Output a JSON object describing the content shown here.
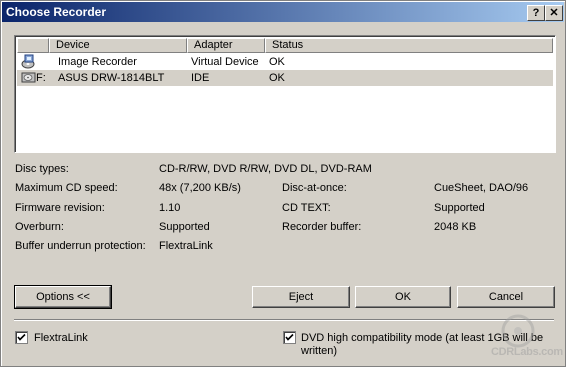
{
  "window": {
    "title": "Choose Recorder",
    "help_button": "?",
    "close_button": "✕"
  },
  "list": {
    "columns": [
      "Device",
      "Adapter",
      "Status"
    ],
    "rows": [
      {
        "prefix": "",
        "device": "Image Recorder",
        "adapter": "Virtual Device",
        "status": "OK",
        "icon": "image-recorder-icon"
      },
      {
        "prefix": "F:",
        "device": "ASUS DRW-1814BLT",
        "adapter": "IDE",
        "status": "OK",
        "icon": "optical-drive-icon"
      }
    ]
  },
  "info": {
    "disc_types_label": "Disc types:",
    "disc_types_value": "CD-R/RW, DVD R/RW, DVD DL, DVD-RAM",
    "max_speed_label": "Maximum CD speed:",
    "max_speed_value": "48x (7,200 KB/s)",
    "firmware_label": "Firmware revision:",
    "firmware_value": "1.10",
    "overburn_label": "Overburn:",
    "overburn_value": "Supported",
    "buffer_protect_label": "Buffer underrun protection:",
    "buffer_protect_value": "FlextraLink",
    "dao_label": "Disc-at-once:",
    "dao_value": "CueSheet, DAO/96",
    "cdtext_label": "CD TEXT:",
    "cdtext_value": "Supported",
    "rec_buffer_label": "Recorder buffer:",
    "rec_buffer_value": "2048 KB"
  },
  "buttons": {
    "options": "Options <<",
    "eject": "Eject",
    "ok": "OK",
    "cancel": "Cancel"
  },
  "checkboxes": {
    "flextralink_label": "FlextraLink",
    "flextralink_checked": true,
    "dvd_compat_label_line1": "DVD high compatibility mode (at least 1GB will be",
    "dvd_compat_label_line2": "written)",
    "dvd_compat_checked": true
  },
  "watermark": "CDRLabs.com"
}
